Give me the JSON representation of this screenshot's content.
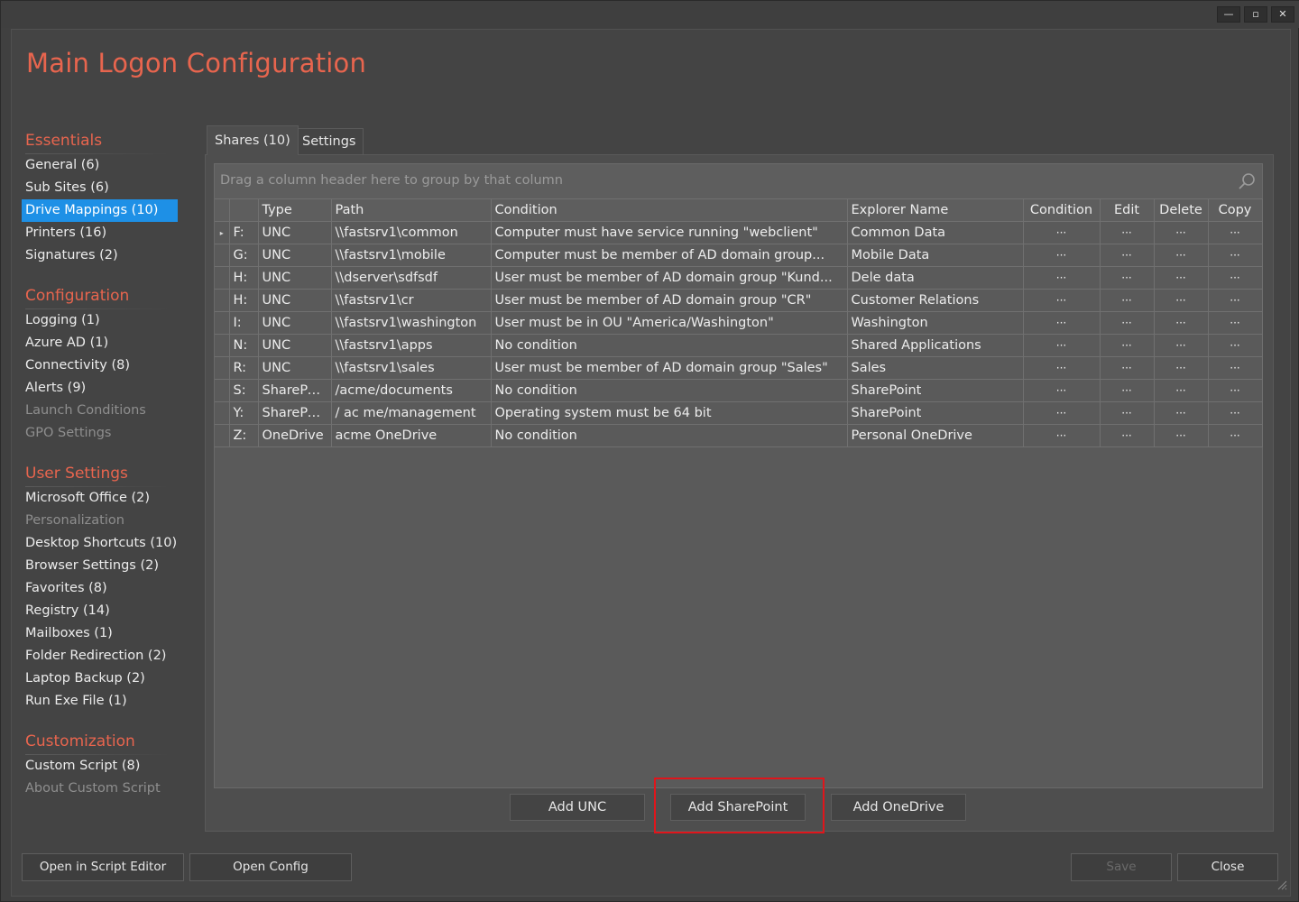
{
  "window": {
    "title": "Main Logon Configuration",
    "controls": {
      "minimize": "—",
      "maximize": "▫",
      "close": "✕"
    }
  },
  "sidebar": {
    "sections": [
      {
        "title": "Essentials",
        "items": [
          {
            "label": "General (6)",
            "state": "normal"
          },
          {
            "label": "Sub Sites (6)",
            "state": "normal"
          },
          {
            "label": "Drive Mappings (10)",
            "state": "selected"
          },
          {
            "label": "Printers (16)",
            "state": "normal"
          },
          {
            "label": "Signatures (2)",
            "state": "normal"
          }
        ]
      },
      {
        "title": "Configuration",
        "items": [
          {
            "label": "Logging (1)",
            "state": "normal"
          },
          {
            "label": "Azure AD (1)",
            "state": "normal"
          },
          {
            "label": "Connectivity (8)",
            "state": "normal"
          },
          {
            "label": "Alerts (9)",
            "state": "normal"
          },
          {
            "label": "Launch Conditions",
            "state": "disabled"
          },
          {
            "label": "GPO Settings",
            "state": "disabled"
          }
        ]
      },
      {
        "title": "User Settings",
        "items": [
          {
            "label": "Microsoft Office (2)",
            "state": "normal"
          },
          {
            "label": "Personalization",
            "state": "disabled"
          },
          {
            "label": "Desktop Shortcuts (10)",
            "state": "normal"
          },
          {
            "label": "Browser Settings (2)",
            "state": "normal"
          },
          {
            "label": "Favorites (8)",
            "state": "normal"
          },
          {
            "label": "Registry (14)",
            "state": "normal"
          },
          {
            "label": "Mailboxes (1)",
            "state": "normal"
          },
          {
            "label": "Folder Redirection (2)",
            "state": "normal"
          },
          {
            "label": "Laptop Backup (2)",
            "state": "normal"
          },
          {
            "label": "Run Exe File (1)",
            "state": "normal"
          }
        ]
      },
      {
        "title": "Customization",
        "items": [
          {
            "label": "Custom Script (8)",
            "state": "normal"
          },
          {
            "label": "About Custom Script",
            "state": "disabled"
          }
        ]
      }
    ]
  },
  "tabs": [
    {
      "label": "Shares (10)",
      "active": true
    },
    {
      "label": "Settings",
      "active": false
    }
  ],
  "grid": {
    "group_placeholder": "Drag a column header here to group by that column",
    "columns": [
      "",
      "",
      "Type",
      "Path",
      "Condition",
      "Explorer Name",
      "Condition",
      "Edit",
      "Delete",
      "Copy"
    ],
    "action_glyph": "···",
    "current_row_glyph": "▸",
    "rows": [
      {
        "drive": "F:",
        "type": "UNC",
        "path": "\\\\fastsrv1\\common",
        "condition": "Computer must have service running \"webclient\"",
        "explorer_name": "Common Data",
        "current": true
      },
      {
        "drive": "G:",
        "type": "UNC",
        "path": "\\\\fastsrv1\\mobile",
        "condition": "Computer must be member of AD domain group...",
        "explorer_name": "Mobile Data",
        "current": false
      },
      {
        "drive": "H:",
        "type": "UNC",
        "path": "\\\\dserver\\sdfsdf",
        "condition": "User must be member of AD domain group \"Kund...",
        "explorer_name": "Dele data",
        "current": false
      },
      {
        "drive": "H:",
        "type": "UNC",
        "path": "\\\\fastsrv1\\cr",
        "condition": "User must be member of AD domain group \"CR\"",
        "explorer_name": "Customer Relations",
        "current": false
      },
      {
        "drive": "I:",
        "type": "UNC",
        "path": "\\\\fastsrv1\\washington",
        "condition": "User must be in OU \"America/Washington\"",
        "explorer_name": "Washington",
        "current": false
      },
      {
        "drive": "N:",
        "type": "UNC",
        "path": "\\\\fastsrv1\\apps",
        "condition": "No condition",
        "explorer_name": "Shared Applications",
        "current": false
      },
      {
        "drive": "R:",
        "type": "UNC",
        "path": "\\\\fastsrv1\\sales",
        "condition": "User must be member of AD domain group \"Sales\"",
        "explorer_name": "Sales",
        "current": false
      },
      {
        "drive": "S:",
        "type": "SharePo...",
        "path": "/acme/documents",
        "condition": "No condition",
        "explorer_name": "SharePoint",
        "current": false
      },
      {
        "drive": "Y:",
        "type": "SharePo...",
        "path": "/ ac me/management",
        "condition": "Operating system must be 64 bit",
        "explorer_name": "SharePoint",
        "current": false
      },
      {
        "drive": "Z:",
        "type": "OneDrive",
        "path": "acme OneDrive",
        "condition": "No condition",
        "explorer_name": "Personal OneDrive",
        "current": false
      }
    ]
  },
  "actions": {
    "add_unc": "Add UNC",
    "add_sharepoint": "Add SharePoint",
    "add_onedrive": "Add OneDrive"
  },
  "footer": {
    "open_script_editor": "Open in Script Editor",
    "open_config": "Open Config",
    "save": "Save",
    "close": "Close"
  },
  "icons": {
    "search": "search-icon",
    "resize_grip": "resize-grip-icon"
  },
  "colors": {
    "accent": "#e8654e",
    "selection": "#1e90e6",
    "highlight_box": "#e0151b"
  }
}
